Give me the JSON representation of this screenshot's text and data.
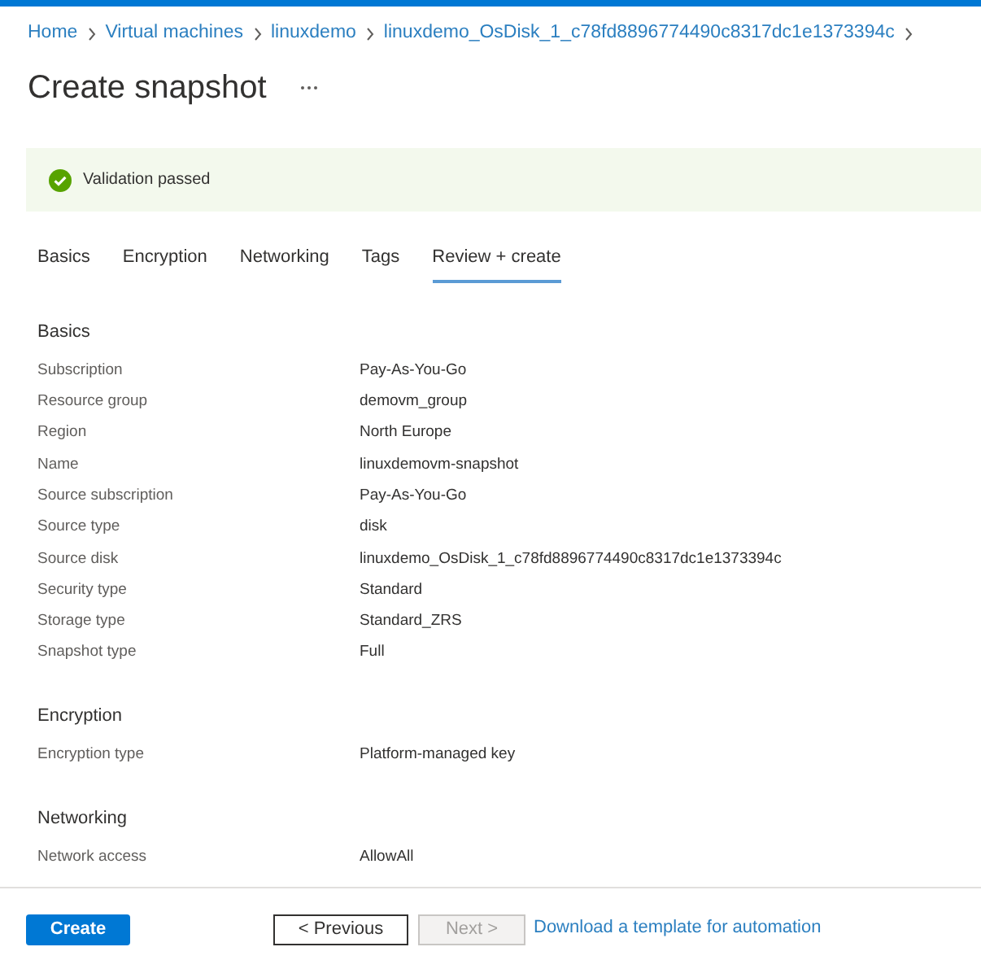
{
  "breadcrumb": [
    {
      "label": "Home"
    },
    {
      "label": "Virtual machines"
    },
    {
      "label": "linuxdemo"
    },
    {
      "label": "linuxdemo_OsDisk_1_c78fd8896774490c8317dc1e1373394c"
    }
  ],
  "page_title": "Create snapshot",
  "validation": {
    "passed": true,
    "message": "Validation passed"
  },
  "tabs": [
    {
      "label": "Basics",
      "selected": false
    },
    {
      "label": "Encryption",
      "selected": false
    },
    {
      "label": "Networking",
      "selected": false
    },
    {
      "label": "Tags",
      "selected": false
    },
    {
      "label": "Review + create",
      "selected": true
    }
  ],
  "sections": [
    {
      "title": "Basics",
      "rows": [
        {
          "label": "Subscription",
          "value": "Pay-As-You-Go"
        },
        {
          "label": "Resource group",
          "value": "demovm_group"
        },
        {
          "label": "Region",
          "value": "North Europe"
        },
        {
          "label": "Name",
          "value": "linuxdemovm-snapshot"
        },
        {
          "label": "Source subscription",
          "value": "Pay-As-You-Go"
        },
        {
          "label": "Source type",
          "value": "disk"
        },
        {
          "label": "Source disk",
          "value": "linuxdemo_OsDisk_1_c78fd8896774490c8317dc1e1373394c"
        },
        {
          "label": "Security type",
          "value": "Standard"
        },
        {
          "label": "Storage type",
          "value": "Standard_ZRS"
        },
        {
          "label": "Snapshot type",
          "value": "Full"
        }
      ]
    },
    {
      "title": "Encryption",
      "rows": [
        {
          "label": "Encryption type",
          "value": "Platform-managed key"
        }
      ]
    },
    {
      "title": "Networking",
      "rows": [
        {
          "label": "Network access",
          "value": "AllowAll"
        }
      ]
    }
  ],
  "footer": {
    "buttons": [
      {
        "label": "Create",
        "kind": "primary",
        "disabled": false
      },
      {
        "label": "< Previous",
        "kind": "secondary",
        "disabled": false
      },
      {
        "label": "Next >",
        "kind": "secondary",
        "disabled": true
      }
    ],
    "link": "Download a template for automation"
  }
}
